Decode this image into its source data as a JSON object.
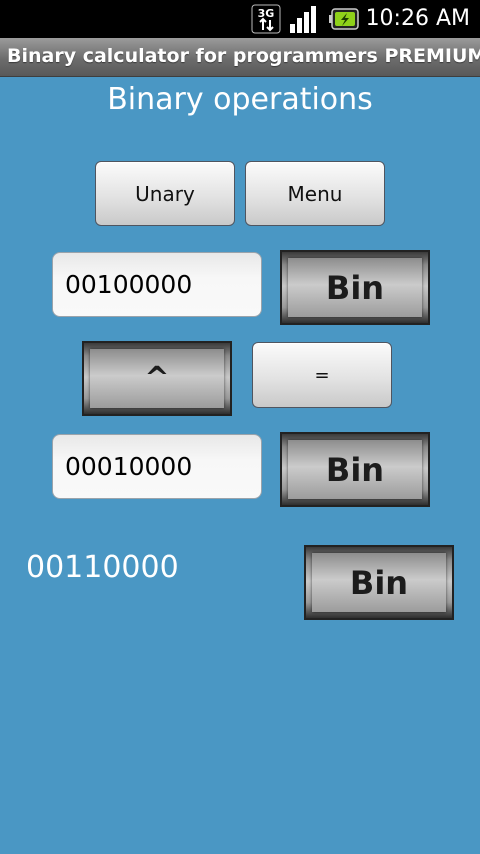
{
  "status_bar": {
    "time": "10:26 AM",
    "network_label": "3G",
    "icons": [
      "3g-data-icon",
      "signal-icon",
      "battery-charging-icon"
    ]
  },
  "app": {
    "title": "Binary calculator for programmers PREMIUM"
  },
  "main": {
    "heading": "Binary operations",
    "unary_label": "Unary",
    "menu_label": "Menu",
    "operand_1": "00100000",
    "operand_2": "00010000",
    "operator_label": "^",
    "equals_label": "=",
    "result": "00110000",
    "base_1_label": "Bin",
    "base_2_label": "Bin",
    "base_result_label": "Bin"
  },
  "colors": {
    "background": "#4a97c4",
    "title_bar": "#6c6c6c",
    "status_bar": "#000000"
  }
}
